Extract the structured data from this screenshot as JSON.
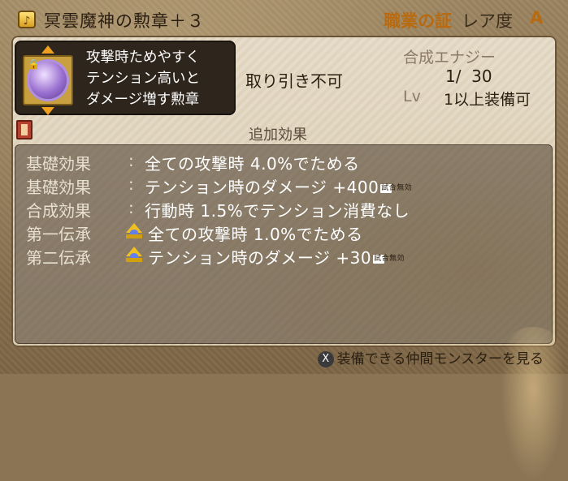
{
  "header": {
    "icon_symbol": "♪",
    "item_name": "冥雲魔神の勲章＋３",
    "job_proof": "職業の証",
    "rarity_label": "レア度",
    "rarity_value": "A"
  },
  "description": {
    "lines": [
      "攻撃時ためやすく",
      "テンション高いと",
      "ダメージ増す勲章"
    ]
  },
  "info": {
    "trade": "取り引き不可",
    "synth_label": "合成エナジー",
    "synth_value": "1/  30",
    "lv_label": "Lv",
    "lv_text": "1以上装備可"
  },
  "extra_effects": {
    "header": "追加効果",
    "rows": [
      {
        "label": "基礎効果",
        "colon": ":",
        "value": "全ての攻撃時 4.0%でためる",
        "tag": ""
      },
      {
        "label": "基礎効果",
        "colon": ":",
        "value": "テンション時のダメージ +400",
        "tag": "試合無効"
      },
      {
        "label": "合成効果",
        "colon": ":",
        "value": "行動時 1.5%でテンション消費なし",
        "tag": ""
      },
      {
        "label": "第一伝承",
        "colon": "",
        "value": "全ての攻撃時 1.0%でためる",
        "tag": ""
      },
      {
        "label": "第二伝承",
        "colon": "",
        "value": "テンション時のダメージ +30",
        "tag": "試合無効"
      }
    ]
  },
  "footer": {
    "button_symbol": "X",
    "text": "装備できる仲間モンスターを見る"
  },
  "colors": {
    "accent_orange": "#b86a10",
    "desc_bg": "#2e251c",
    "parchment": "#e6dcc8"
  }
}
